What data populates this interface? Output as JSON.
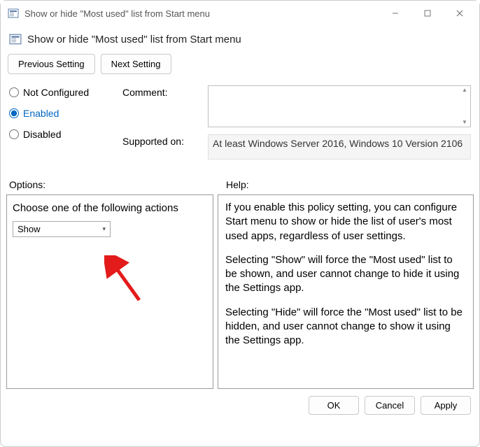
{
  "window": {
    "title": "Show or hide \"Most used\" list from Start menu"
  },
  "header": {
    "title": "Show or hide \"Most used\" list from Start menu"
  },
  "nav": {
    "previous": "Previous Setting",
    "next": "Next Setting"
  },
  "radios": {
    "not_configured": "Not Configured",
    "enabled": "Enabled",
    "disabled": "Disabled",
    "selected": "enabled"
  },
  "labels": {
    "comment": "Comment:",
    "supported_on": "Supported on:",
    "options": "Options:",
    "help": "Help:"
  },
  "comment_value": "",
  "supported_on_value": "At least Windows Server 2016, Windows 10 Version 2106",
  "options": {
    "prompt": "Choose one of the following actions",
    "selected": "Show"
  },
  "help_text": {
    "p1": "If you enable this policy setting, you can configure Start menu to show or hide the list of user's most used apps, regardless of user settings.",
    "p2": "Selecting \"Show\" will force the \"Most used\" list to be shown, and user cannot change to hide it using the Settings app.",
    "p3": "Selecting \"Hide\" will force the \"Most used\" list to be hidden, and user cannot change to show it using the Settings app."
  },
  "footer": {
    "ok": "OK",
    "cancel": "Cancel",
    "apply": "Apply"
  }
}
